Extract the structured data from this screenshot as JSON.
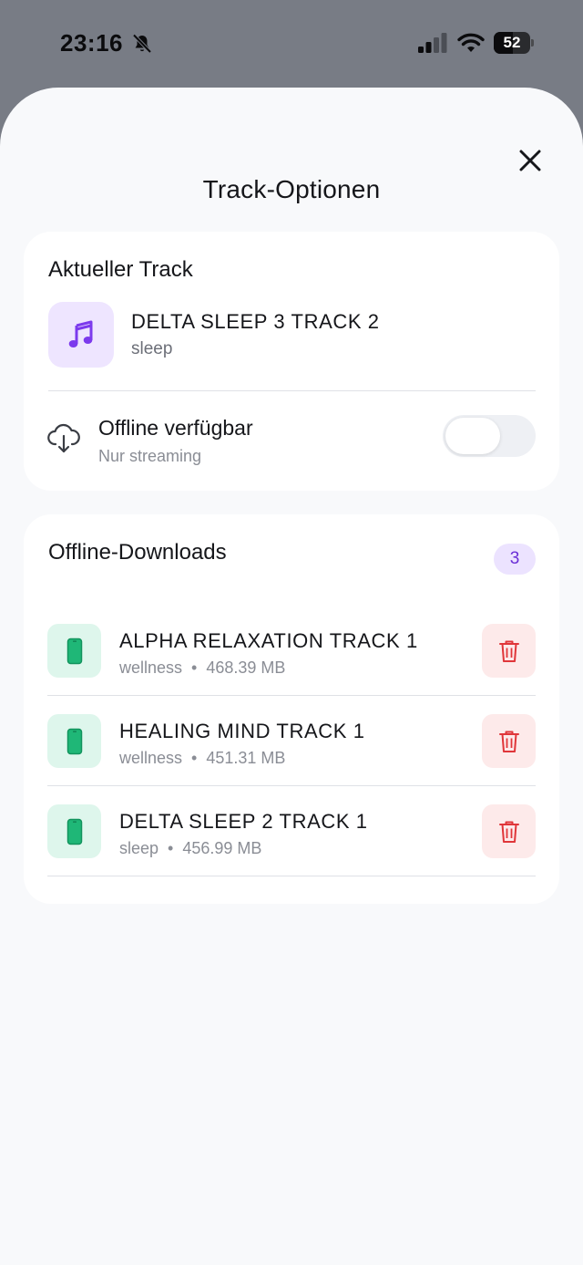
{
  "status_bar": {
    "time": "23:16",
    "battery_level": "52",
    "battery_fraction": 0.52,
    "icons": [
      "bell-slash-icon",
      "signal-icon",
      "wifi-icon",
      "battery-icon"
    ]
  },
  "sheet": {
    "title": "Track-Optionen",
    "close_icon": "close-icon"
  },
  "current_track": {
    "heading": "Aktueller Track",
    "title": "DELTA SLEEP 3 TRACK 2",
    "category": "sleep",
    "thumb_icon": "music-note-icon",
    "offline": {
      "label": "Offline verfügbar",
      "status": "Nur streaming",
      "enabled": false,
      "icon": "cloud-download-icon"
    }
  },
  "downloads": {
    "heading": "Offline-Downloads",
    "count": "3",
    "items": [
      {
        "title": "ALPHA RELAXATION TRACK 1",
        "category": "wellness",
        "separator": "•",
        "size": "468.39 MB"
      },
      {
        "title": "HEALING MIND TRACK 1",
        "category": "wellness",
        "separator": "•",
        "size": "451.31 MB"
      },
      {
        "title": "DELTA SLEEP 2 TRACK 1",
        "category": "sleep",
        "separator": "•",
        "size": "456.99 MB"
      }
    ],
    "item_icon": "phone-icon",
    "delete_icon": "trash-icon"
  },
  "colors": {
    "accent_purple": "#7c3aed",
    "accent_green": "#1fb777",
    "danger_red": "#e0363a",
    "sheet_bg": "#f8f9fb",
    "backdrop": "#787c85"
  }
}
